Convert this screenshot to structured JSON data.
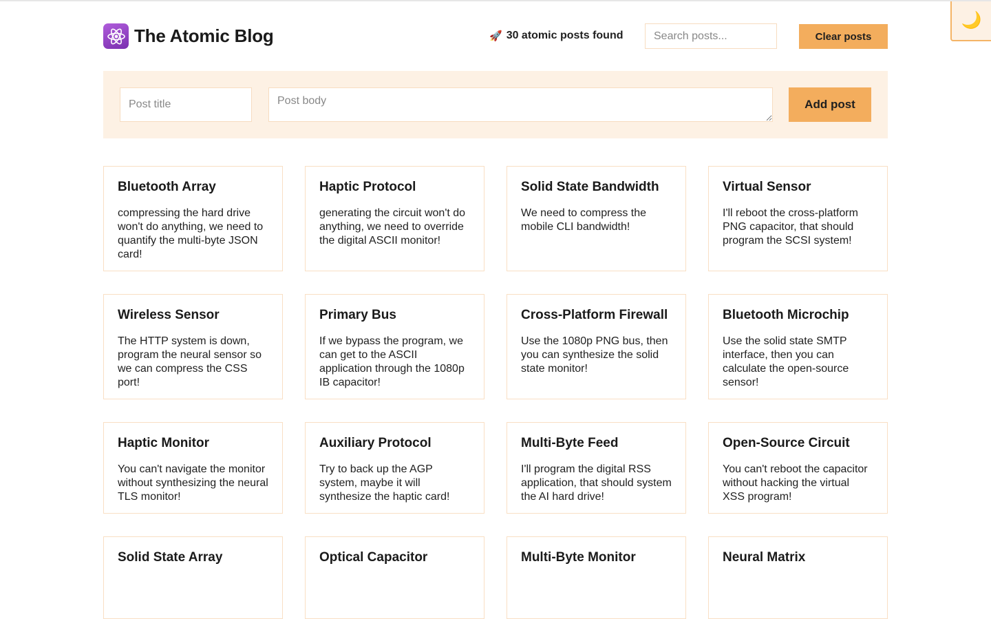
{
  "header": {
    "title": "The Atomic Blog",
    "logo_icon": "atom-icon",
    "posts_found_emoji": "🚀",
    "posts_found_text": "30 atomic posts found",
    "search_placeholder": "Search posts...",
    "search_value": "",
    "clear_label": "Clear posts"
  },
  "theme_toggle": {
    "icon": "moon-icon",
    "glyph": "🌙"
  },
  "form": {
    "title_placeholder": "Post title",
    "body_placeholder": "Post body",
    "add_label": "Add post"
  },
  "posts": [
    {
      "title": "Bluetooth Array",
      "body": "compressing the hard drive won't do anything, we need to quantify the multi-byte JSON card!"
    },
    {
      "title": "Haptic Protocol",
      "body": "generating the circuit won't do anything, we need to override the digital ASCII monitor!"
    },
    {
      "title": "Solid State Bandwidth",
      "body": "We need to compress the mobile CLI bandwidth!"
    },
    {
      "title": "Virtual Sensor",
      "body": "I'll reboot the cross-platform PNG capacitor, that should program the SCSI system!"
    },
    {
      "title": "Wireless Sensor",
      "body": "The HTTP system is down, program the neural sensor so we can compress the CSS port!"
    },
    {
      "title": "Primary Bus",
      "body": "If we bypass the program, we can get to the ASCII application through the 1080p IB capacitor!"
    },
    {
      "title": "Cross-Platform Firewall",
      "body": "Use the 1080p PNG bus, then you can synthesize the solid state monitor!"
    },
    {
      "title": "Bluetooth Microchip",
      "body": "Use the solid state SMTP interface, then you can calculate the open-source sensor!"
    },
    {
      "title": "Haptic Monitor",
      "body": "You can't navigate the monitor without synthesizing the neural TLS monitor!"
    },
    {
      "title": "Auxiliary Protocol",
      "body": "Try to back up the AGP system, maybe it will synthesize the haptic card!"
    },
    {
      "title": "Multi-Byte Feed",
      "body": "I'll program the digital RSS application, that should system the AI hard drive!"
    },
    {
      "title": "Open-Source Circuit",
      "body": "You can't reboot the capacitor without hacking the virtual XSS program!"
    },
    {
      "title": "Solid State Array",
      "body": ""
    },
    {
      "title": "Optical Capacitor",
      "body": ""
    },
    {
      "title": "Multi-Byte Monitor",
      "body": ""
    },
    {
      "title": "Neural Matrix",
      "body": ""
    }
  ]
}
